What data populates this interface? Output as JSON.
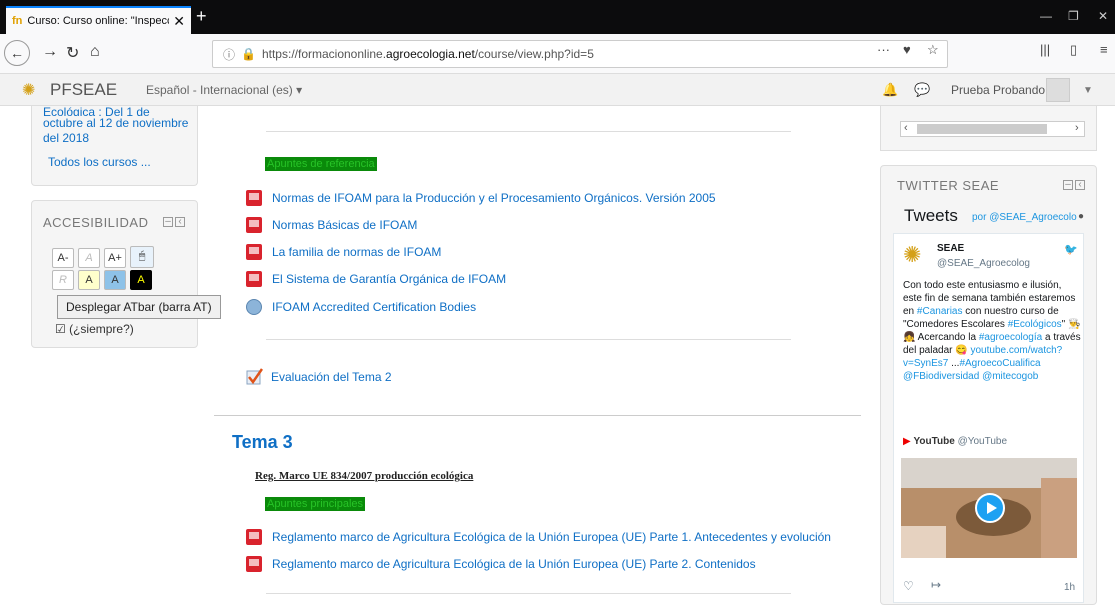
{
  "browser": {
    "tab_title": "Curso: Curso online: \"Inspeccio",
    "tab_favicon": "fn",
    "url_prefix": "https://formaciononline.",
    "url_domain": "agroecologia.net",
    "url_path": "/course/view.php?id=5"
  },
  "header": {
    "site_name": "PFSEAE",
    "language": "Español - Internacional (es) ▾",
    "user_name": "Prueba Probando"
  },
  "left": {
    "course_tail": "Ecológica : Del 1 de",
    "course_line2": "octubre al 12 de noviembre",
    "course_line3": "del 2018",
    "all_courses": "Todos los cursos ...",
    "access_title": "ACCESIBILIDAD",
    "btn_a_minus": "A-",
    "btn_a_reset": "A",
    "btn_a_plus": "A+",
    "btn_r": "R",
    "btn_a1": "A",
    "btn_a2": "A",
    "btn_a3": "A",
    "tooltip": "Desplegar ATbar (barra AT)",
    "always": "(¿siempre?)"
  },
  "main": {
    "apuntes_ref": "Apuntes de referencia",
    "resources": [
      "Normas de IFOAM para la Producción y el Procesamiento Orgánicos. Versión 2005",
      "Normas Básicas de IFOAM",
      "La familia de normas de IFOAM",
      "El Sistema de Garantía Orgánica de IFOAM",
      "IFOAM Accredited Certification Bodies"
    ],
    "evaluacion": "Evaluación del Tema 2",
    "tema3": "Tema 3",
    "reg_title": "Reg. Marco UE 834/2007 producción ecológica",
    "apuntes_main": "Apuntes principales",
    "reglamentos": [
      "Reglamento marco de Agricultura Ecológica de la Unión Europea (UE) Parte 1. Antecedentes y evolución",
      "Reglamento marco de Agricultura Ecológica de la Unión Europea (UE) Parte 2. Contenidos"
    ]
  },
  "twitter": {
    "block_title": "TWITTER SEAE",
    "tweets": "Tweets",
    "by": "por @SEAE_Agroecolo",
    "author": "SEAE",
    "handle": "@SEAE_Agroecolog",
    "text1": "Con todo este entusiasmo e ilusión, este fin de semana también estaremos en ",
    "tag1": "#Canarias",
    "text2": " con nuestro curso de \"Comedores Escolares ",
    "tag2": "#Ecológicos",
    "text3": "\" 👨‍🍳👧 Acercando la ",
    "tag3": "#agroecología",
    "text4": " a través del paladar 😋 ",
    "link": "youtube.com/watch?v=SynEs7",
    "text5": " ...",
    "tags_end": "#AgroecoCualifica @FBiodiversidad @mitecogob",
    "yt_name": "YouTube",
    "yt_handle": "@YouTube",
    "time": "1h"
  }
}
